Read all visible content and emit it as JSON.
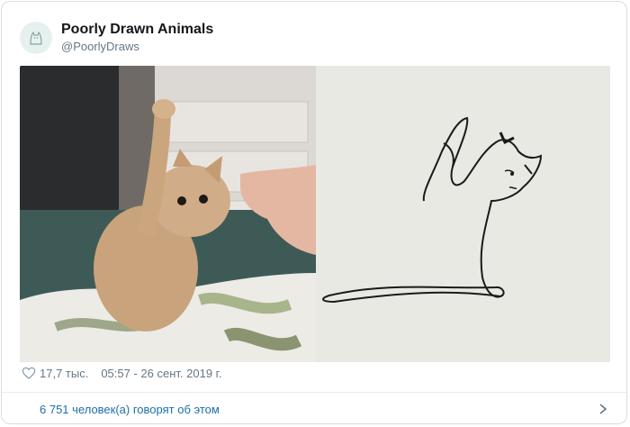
{
  "author": {
    "display_name": "Poorly Drawn Animals",
    "handle": "@PoorlyDraws",
    "avatar_icon": "cat-sketch-icon"
  },
  "media": {
    "photo_description_icon": "kitten-photo",
    "drawing_description_icon": "cat-line-drawing"
  },
  "meta": {
    "heart_icon": "heart-outline-icon",
    "likes": "17,7 тыс.",
    "timestamp": "05:57 - 26 сент. 2019 г."
  },
  "footer": {
    "talking": "6 751 человек(а) говорят об этом",
    "chevron_icon": "chevron-right-icon"
  },
  "colors": {
    "link": "#1b6fa8",
    "muted": "#657786",
    "border": "#d7dee4"
  }
}
